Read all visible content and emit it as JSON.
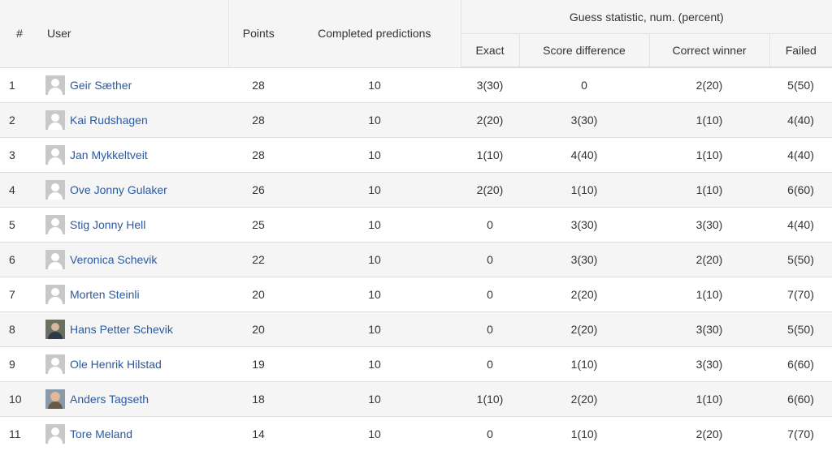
{
  "header": {
    "rank": "#",
    "user": "User",
    "points": "Points",
    "completed": "Completed predictions",
    "group": "Guess statistic, num. (percent)",
    "exact": "Exact",
    "score_difference": "Score difference",
    "correct_winner": "Correct winner",
    "failed": "Failed"
  },
  "rows": [
    {
      "rank": "1",
      "user": "Geir Sæther",
      "avatar": "user-avatar-icon",
      "points": "28",
      "completed": "10",
      "exact": "3(30)",
      "score_difference": "0",
      "correct_winner": "2(20)",
      "failed": "5(50)"
    },
    {
      "rank": "2",
      "user": "Kai Rudshagen",
      "avatar": "user-avatar-icon",
      "points": "28",
      "completed": "10",
      "exact": "2(20)",
      "score_difference": "3(30)",
      "correct_winner": "1(10)",
      "failed": "4(40)"
    },
    {
      "rank": "3",
      "user": "Jan Mykkeltveit",
      "avatar": "user-avatar-icon",
      "points": "28",
      "completed": "10",
      "exact": "1(10)",
      "score_difference": "4(40)",
      "correct_winner": "1(10)",
      "failed": "4(40)"
    },
    {
      "rank": "4",
      "user": "Ove Jonny Gulaker",
      "avatar": "user-avatar-icon",
      "points": "26",
      "completed": "10",
      "exact": "2(20)",
      "score_difference": "1(10)",
      "correct_winner": "1(10)",
      "failed": "6(60)"
    },
    {
      "rank": "5",
      "user": "Stig Jonny Hell",
      "avatar": "user-avatar-icon",
      "points": "25",
      "completed": "10",
      "exact": "0",
      "score_difference": "3(30)",
      "correct_winner": "3(30)",
      "failed": "4(40)"
    },
    {
      "rank": "6",
      "user": "Veronica Schevik",
      "avatar": "user-avatar-icon",
      "points": "22",
      "completed": "10",
      "exact": "0",
      "score_difference": "3(30)",
      "correct_winner": "2(20)",
      "failed": "5(50)"
    },
    {
      "rank": "7",
      "user": "Morten Steinli",
      "avatar": "user-avatar-icon",
      "points": "20",
      "completed": "10",
      "exact": "0",
      "score_difference": "2(20)",
      "correct_winner": "1(10)",
      "failed": "7(70)"
    },
    {
      "rank": "8",
      "user": "Hans Petter Schevik",
      "avatar": "user-photo",
      "points": "20",
      "completed": "10",
      "exact": "0",
      "score_difference": "2(20)",
      "correct_winner": "3(30)",
      "failed": "5(50)"
    },
    {
      "rank": "9",
      "user": "Ole Henrik Hilstad",
      "avatar": "user-avatar-icon",
      "points": "19",
      "completed": "10",
      "exact": "0",
      "score_difference": "1(10)",
      "correct_winner": "3(30)",
      "failed": "6(60)"
    },
    {
      "rank": "10",
      "user": "Anders Tagseth",
      "avatar": "user-photo",
      "points": "18",
      "completed": "10",
      "exact": "1(10)",
      "score_difference": "2(20)",
      "correct_winner": "1(10)",
      "failed": "6(60)"
    },
    {
      "rank": "11",
      "user": "Tore Meland",
      "avatar": "user-avatar-icon",
      "points": "14",
      "completed": "10",
      "exact": "0",
      "score_difference": "1(10)",
      "correct_winner": "2(20)",
      "failed": "7(70)"
    }
  ],
  "colors": {
    "link": "#2a5aa0",
    "header_bg": "#f5f5f5",
    "stripe_bg": "#f5f5f5",
    "text": "#333333"
  }
}
